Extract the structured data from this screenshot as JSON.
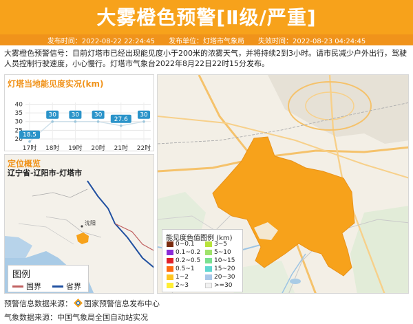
{
  "header": {
    "title": "大雾橙色预警[Ⅱ级/严重]",
    "publish_time": "发布时间：2022-08-22 22:24:45",
    "publisher": "发布单位：灯塔市气象局",
    "expire_time": "失效时间：2022-08-23 04:24:45"
  },
  "description": "大雾橙色预警信号：目前灯塔市已经出现能见度小于200米的浓雾天气，并将持续2到3小时。请市民减少户外出行，驾驶人员控制行驶速度，小心慢行。灯塔市气象台2022年8月22日22时15分发布。",
  "chart_panel": {
    "title": "灯塔当地能见度实况(km)"
  },
  "chart_data": {
    "type": "line",
    "title": "灯塔当地能见度实况(km)",
    "categories": [
      "17时",
      "18时",
      "19时",
      "20时",
      "21时",
      "22时"
    ],
    "values": [
      18.5,
      30,
      30,
      30,
      27.6,
      30
    ],
    "value_labels": [
      "18.5",
      "30",
      "30",
      "30",
      "27.6",
      "30"
    ],
    "yticks": [
      "40",
      "35",
      "30",
      "25",
      "20"
    ],
    "ylim": [
      18,
      41
    ],
    "grid": true,
    "line_color": "#cfe0ea",
    "label_color": "#2a93c9"
  },
  "location": {
    "title": "定位概览",
    "name": "辽宁省-辽阳市-灯塔市",
    "city_label": "沈阳",
    "legend_title": "图例",
    "legend_items": [
      {
        "label": "国界",
        "color": "#c06060"
      },
      {
        "label": "省界",
        "color": "#1f4fa0"
      }
    ]
  },
  "map": {
    "warning_color": "#f7a21b",
    "legend_title": "能见度色值图例 (km)",
    "legend": [
      {
        "label": "0~0.1",
        "color": "#7a2b0f"
      },
      {
        "label": "3~5",
        "color": "#b8e33a"
      },
      {
        "label": "0.1~0.2",
        "color": "#8a2bd8"
      },
      {
        "label": "5~10",
        "color": "#9fe36a"
      },
      {
        "label": "0.2~0.5",
        "color": "#e0202a"
      },
      {
        "label": "10~15",
        "color": "#79e08f"
      },
      {
        "label": "0.5~1",
        "color": "#ff6a10"
      },
      {
        "label": "15~20",
        "color": "#5fd7d0"
      },
      {
        "label": "1~2",
        "color": "#ffc51e"
      },
      {
        "label": "20~30",
        "color": "#a9c7e8"
      },
      {
        "label": "2~3",
        "color": "#ffee33"
      },
      {
        "label": ">=30",
        "color": "#f2f2f2"
      }
    ]
  },
  "footer": {
    "warning_source": "预警信息数据来源：",
    "warning_org": "国家预警信息发布中心",
    "weather_source": "气象数据来源：中国气象局全国自动站实况"
  }
}
